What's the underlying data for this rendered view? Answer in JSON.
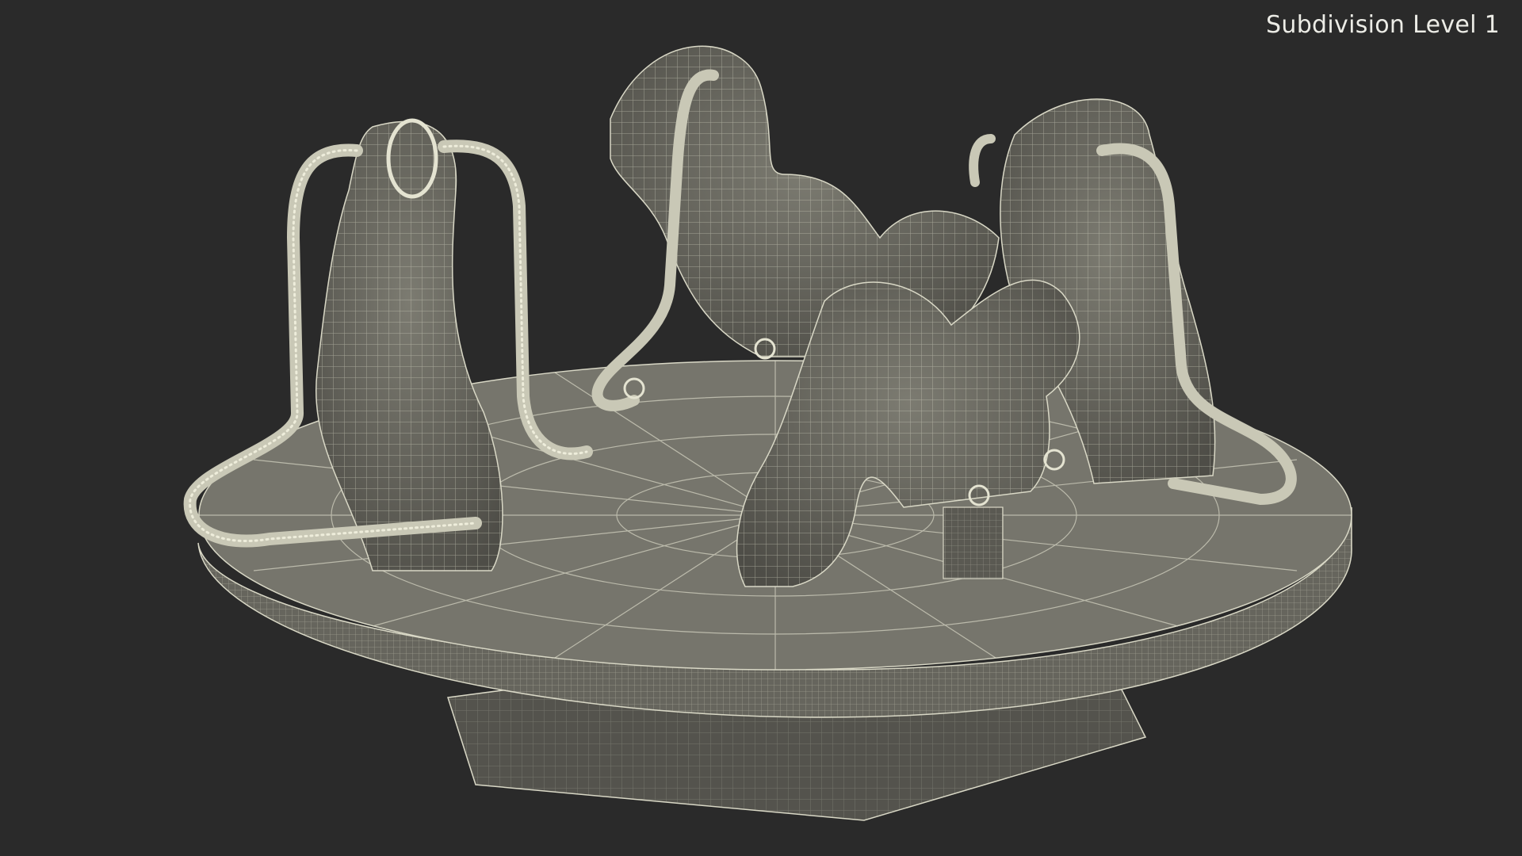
{
  "viewport": {
    "label": "Subdivision Level 1",
    "background_color": "#2a2a2a",
    "mesh_fill_color": "#6e6d64",
    "wire_color": "#d9d8c6",
    "subject": "playground-spinner-with-three-animal-seats-wireframe"
  }
}
